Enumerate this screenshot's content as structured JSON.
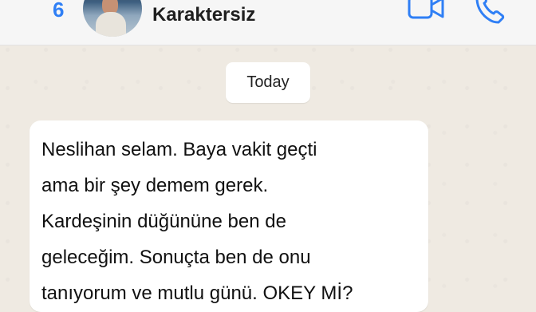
{
  "header": {
    "back_count": "6",
    "contact_name": "Karaktersiz",
    "icons": {
      "video": "video-camera-icon",
      "phone": "phone-icon"
    },
    "accent_color": "#2f7ff5"
  },
  "conversation": {
    "date_label": "Today",
    "message": {
      "text": " Neslihan selam. Baya vakit geçti\nama bir şey demem gerek.\nKardeşinin düğününe ben de\ngeleceğim. Sonuçta ben de onu\ntanıyorum ve mutlu günü. OKEY Mİ?"
    }
  }
}
